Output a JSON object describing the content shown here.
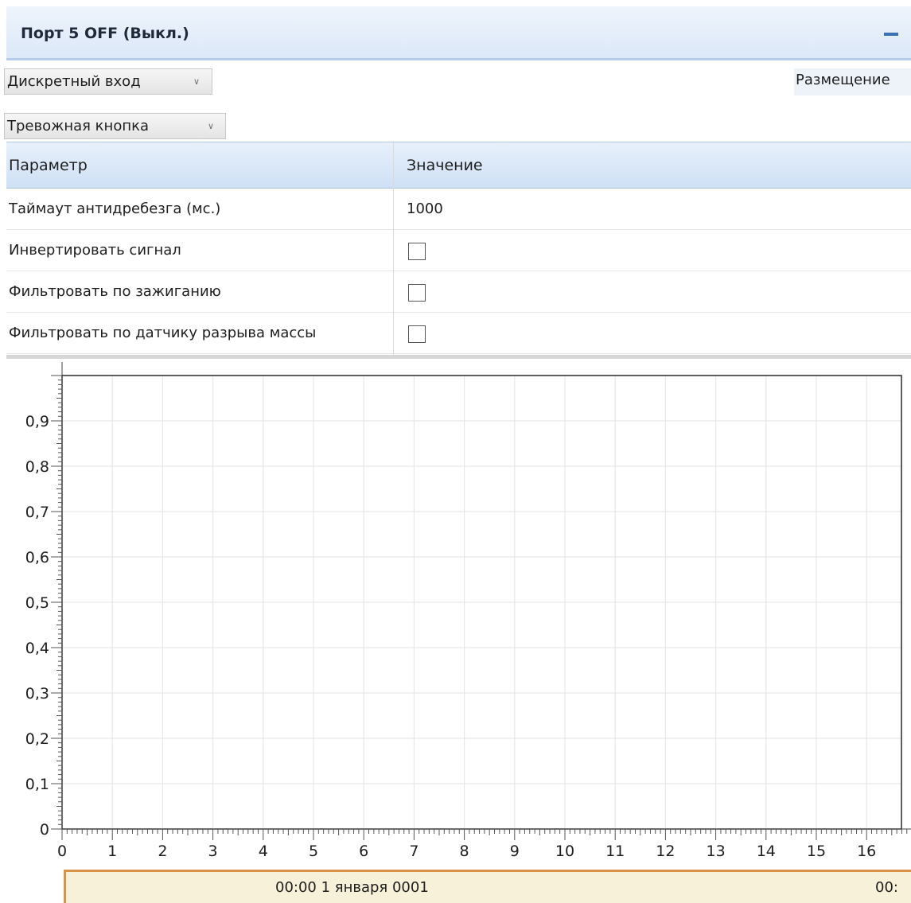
{
  "window": {
    "title": "Порт 5 OFF (Выкл.)"
  },
  "dropdowns": {
    "input_type": "Дискретный вход",
    "function": "Тревожная кнопка"
  },
  "placement_label": "Размещение",
  "table": {
    "headers": [
      "Параметр",
      "Значение"
    ],
    "rows": [
      {
        "name": "Таймаут антидребезга (мс.)",
        "value": "1000"
      },
      {
        "name": "Инвертировать сигнал",
        "checked": false
      },
      {
        "name": "Фильтровать по зажиганию",
        "checked": false
      },
      {
        "name": "Фильтровать по датчику разрыва массы",
        "checked": false
      }
    ]
  },
  "chart_data": {
    "type": "line",
    "y_ticks": [
      "0",
      "0,1",
      "0,2",
      "0,3",
      "0,4",
      "0,5",
      "0,6",
      "0,7",
      "0,8",
      "0,9"
    ],
    "ylim": [
      0,
      1
    ],
    "x_ticks": [
      "0",
      "1",
      "2",
      "3",
      "4",
      "5",
      "6",
      "7",
      "8",
      "9",
      "10",
      "11",
      "12",
      "13",
      "14",
      "15",
      "16"
    ],
    "grid": true,
    "series": []
  },
  "timeline": {
    "label": "00:00 1 января 0001",
    "label_right": "00:"
  }
}
